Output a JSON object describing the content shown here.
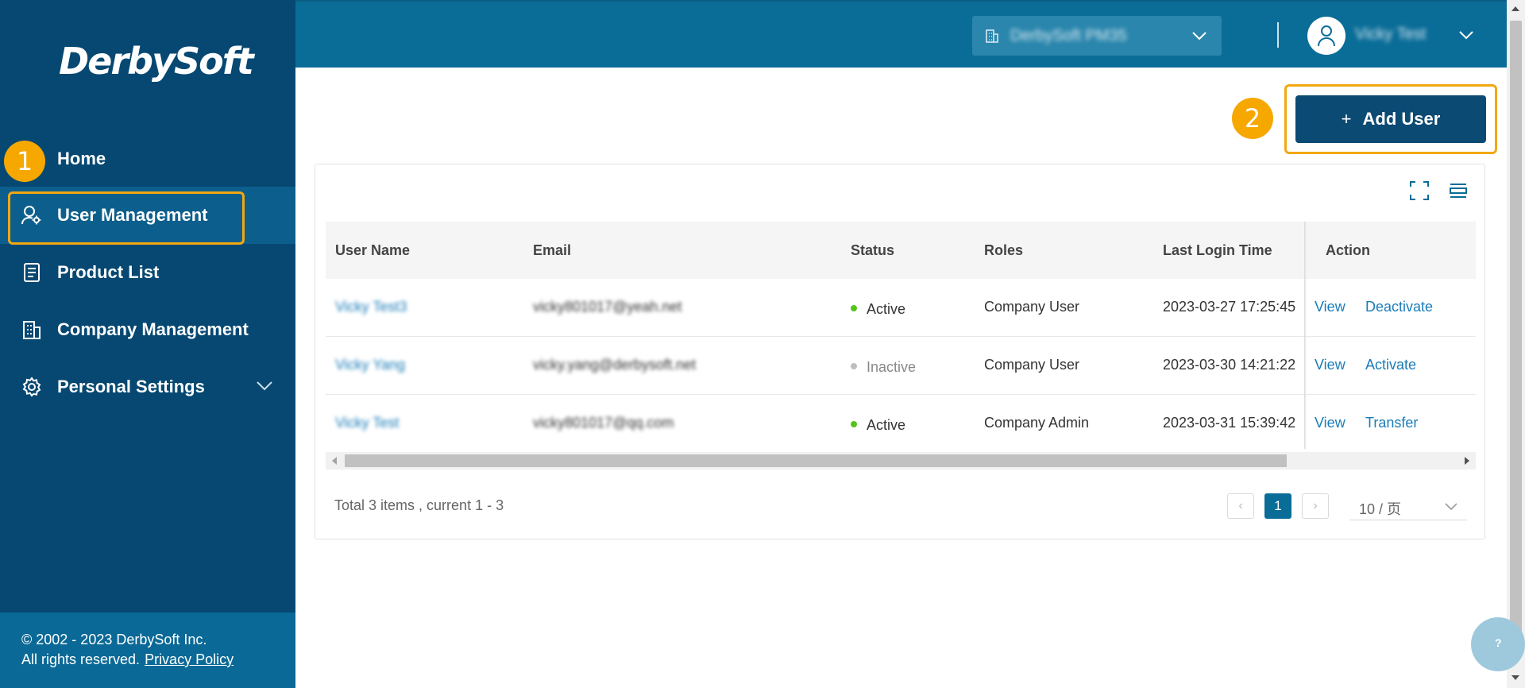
{
  "brand": {
    "logo_text": "DerbySoft"
  },
  "sidebar": {
    "items": [
      {
        "label": "Home",
        "icon": "home",
        "active": false
      },
      {
        "label": "User Management",
        "icon": "user-gear-icon",
        "active": true
      },
      {
        "label": "Product List",
        "icon": "document-list-icon",
        "active": false
      },
      {
        "label": "Company Management",
        "icon": "building-icon",
        "active": false
      },
      {
        "label": "Personal Settings",
        "icon": "gear-icon",
        "active": false,
        "expandable": true
      }
    ],
    "footer": {
      "copyright": "© 2002 - 2023 DerbySoft Inc.",
      "rights": "All rights reserved.",
      "privacy_link": "Privacy Policy"
    }
  },
  "annotations": {
    "step1": "1",
    "step2": "2"
  },
  "header": {
    "company_selector": "DerbySoft PM35",
    "user_name": "Vicky Test"
  },
  "toolbar": {
    "add_user_plus": "+",
    "add_user_label": "Add User"
  },
  "table": {
    "columns": [
      "User Name",
      "Email",
      "Status",
      "Roles",
      "Last Login Time",
      "Action"
    ],
    "rows": [
      {
        "user_name": "Vicky Test3",
        "email": "vicky801017@yeah.net",
        "status": "Active",
        "role": "Company User",
        "last_login": "2023-03-27 17:25:45",
        "action_view": "View",
        "action_other": "Deactivate"
      },
      {
        "user_name": "Vicky Yang",
        "email": "vicky.yang@derbysoft.net",
        "status": "Inactive",
        "role": "Company User",
        "last_login": "2023-03-30 14:21:22",
        "action_view": "View",
        "action_other": "Activate"
      },
      {
        "user_name": "Vicky Test",
        "email": "vicky801017@qq.com",
        "status": "Active",
        "role": "Company Admin",
        "last_login": "2023-03-31 15:39:42",
        "action_view": "View",
        "action_other": "Transfer"
      }
    ]
  },
  "pagination": {
    "total_text": "Total 3 items , current 1 - 3",
    "current_page": "1",
    "prev": "‹",
    "next": "›",
    "page_size": "10 / 页"
  },
  "help": {
    "label": "?"
  },
  "colors": {
    "sidebar_bg": "#064872",
    "header_bg": "#0a6d98",
    "primary_button": "#0b4a73",
    "highlight": "#f3a712",
    "link": "#1a7cb8",
    "active_dot": "#52c41a",
    "inactive_dot": "#bfbfbf"
  }
}
